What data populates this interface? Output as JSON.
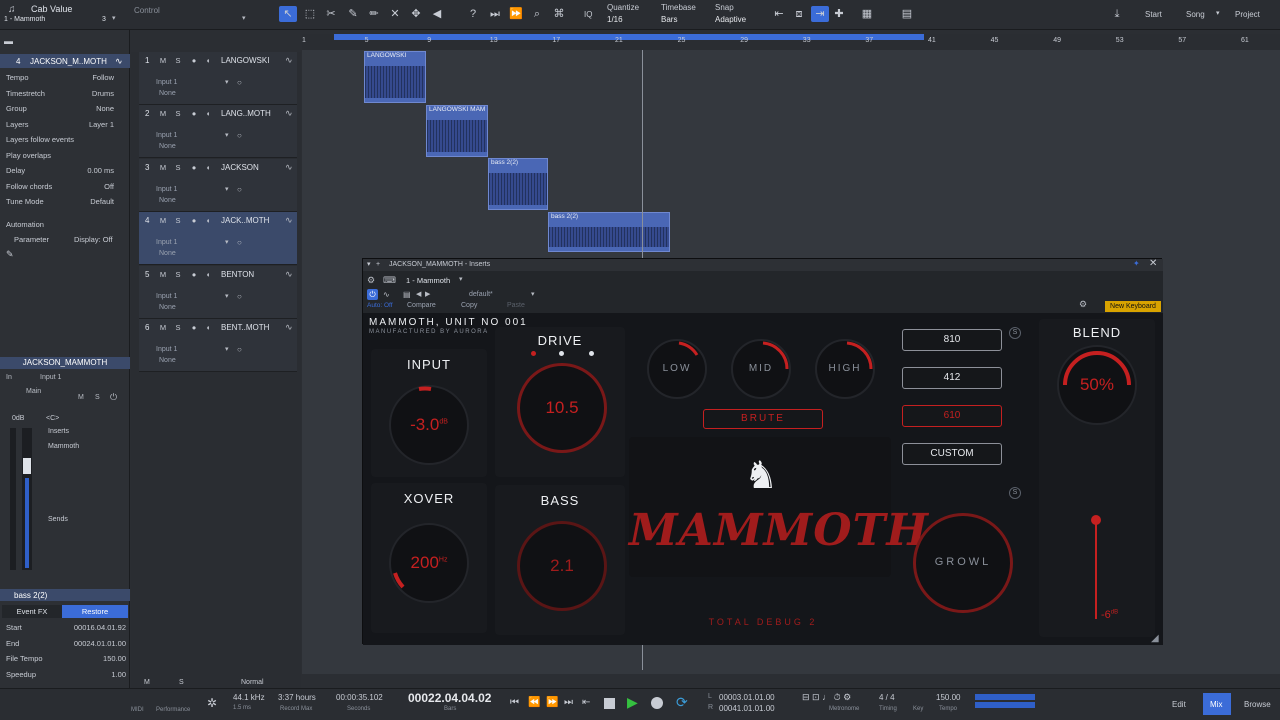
{
  "topbar": {
    "song_title": "Cab Value",
    "track_sel": "1 - Mammoth",
    "track_sel_num": "3",
    "control_label": "Control",
    "quantize_label": "Quantize",
    "quantize_value": "1/16",
    "timebase_label": "Timebase",
    "timebase_value": "Bars",
    "snap_label": "Snap",
    "snap_value": "Adaptive",
    "iq_label": "IQ",
    "nav_start": "Start",
    "nav_song": "Song",
    "nav_project": "Project"
  },
  "inspector": {
    "track_num": "4",
    "track_name": "JACKSON_M..MOTH",
    "rows": [
      {
        "k": "Tempo",
        "v": "Follow"
      },
      {
        "k": "Timestretch",
        "v": "Drums"
      },
      {
        "k": "Group",
        "v": "None"
      },
      {
        "k": "Layers",
        "v": "Layer 1"
      },
      {
        "k": "Layers follow events",
        "v": ""
      },
      {
        "k": "Play overlaps",
        "v": ""
      },
      {
        "k": "Delay",
        "v": "0.00 ms"
      },
      {
        "k": "Follow chords",
        "v": "Off"
      },
      {
        "k": "Tune Mode",
        "v": "Default"
      }
    ],
    "automation_label": "Automation",
    "parameter_label": "Parameter",
    "parameter_value": "Display: Off",
    "channel_name": "JACKSON_MAMMOTH",
    "in_label": "In",
    "in_value": "Input 1",
    "main_label": "Main",
    "db_label": "0dB",
    "c_label": "<C>",
    "inserts_label": "Inserts",
    "insert_item": "Mammoth",
    "sends_label": "Sends",
    "event_name": "bass 2(2)",
    "event_fx": "Event FX",
    "restore": "Restore",
    "event_rows": [
      {
        "k": "Start",
        "v": "00016.04.01.92"
      },
      {
        "k": "End",
        "v": "00024.01.01.00"
      },
      {
        "k": "File Tempo",
        "v": "150.00"
      },
      {
        "k": "Speedup",
        "v": "1.00"
      }
    ]
  },
  "tracks": [
    {
      "num": "1",
      "name": "LANGOWSKI",
      "input": "Input 1",
      "out": "None"
    },
    {
      "num": "2",
      "name": "LANG..MOTH",
      "input": "Input 1",
      "out": "None"
    },
    {
      "num": "3",
      "name": "JACKSON",
      "input": "Input 1",
      "out": "None"
    },
    {
      "num": "4",
      "name": "JACK..MOTH",
      "input": "Input 1",
      "out": "None"
    },
    {
      "num": "5",
      "name": "BENTON",
      "input": "Input 1",
      "out": "None"
    },
    {
      "num": "6",
      "name": "BENT..MOTH",
      "input": "Input 1",
      "out": "None"
    }
  ],
  "track_btns": {
    "m": "M",
    "s": "S"
  },
  "ruler": [
    "1",
    "5",
    "9",
    "13",
    "17",
    "21",
    "25",
    "29",
    "33",
    "37",
    "41",
    "45",
    "49",
    "53",
    "57",
    "61"
  ],
  "clips": [
    {
      "name": "LANGOWSKI"
    },
    {
      "name": "LANGOWSKI MAM"
    },
    {
      "name": "bass 2(2)"
    },
    {
      "name": "bass 2(2)"
    }
  ],
  "plugin": {
    "window_title": "JACKSON_MAMMOTH - Inserts",
    "preset_slot": "1 - Mammoth",
    "preset": "default*",
    "auto_off": "Auto: Off",
    "compare": "Compare",
    "copy": "Copy",
    "paste": "Paste",
    "new_keyboard": "New Keyboard",
    "header": "MAMMOTH, UNIT NO 001",
    "subheader": "MANUFACTURED BY AURORA",
    "input_label": "INPUT",
    "input_value": "-3.0",
    "input_unit": "dB",
    "drive_label": "DRIVE",
    "drive_value": "10.5",
    "low_label": "LOW",
    "mid_label": "MID",
    "high_label": "HIGH",
    "brute_label": "BRUTE",
    "cab_810": "810",
    "cab_412": "412",
    "cab_610": "610",
    "cab_custom": "CUSTOM",
    "blend_label": "BLEND",
    "blend_value": "50",
    "blend_unit": "%",
    "xover_label": "XOVER",
    "xover_value": "200",
    "xover_unit": "Hz",
    "bass_label": "BASS",
    "bass_value": "2.1",
    "logo_text": "MAMMOTH",
    "growl_label": "GROWL",
    "out_value": "-6",
    "out_unit": "dB",
    "footer": "TOTAL DEBUG 2"
  },
  "transport": {
    "midi": "MIDI",
    "performance": "Performance",
    "sample_rate": "44.1 kHz",
    "latency": "1.5 ms",
    "record_max_val": "3:37 hours",
    "record_max": "Record Max",
    "seconds_val": "00:00:35.102",
    "seconds": "Seconds",
    "bars_val": "00022.04.04.02",
    "bars": "Bars",
    "loop_start": "00003.01.01.00",
    "loop_end": "00041.01.01.00",
    "metronome": "Metronome",
    "timing_val": "4 / 4",
    "timing": "Timing",
    "key": "Key",
    "tempo_val": "150.00",
    "tempo": "Tempo",
    "edit": "Edit",
    "mix": "Mix",
    "browse": "Browse",
    "normal": "Normal"
  },
  "colors": {
    "accent": "#3b6cd8",
    "plugin_red": "#c52020",
    "new_kb": "#d8a300"
  }
}
